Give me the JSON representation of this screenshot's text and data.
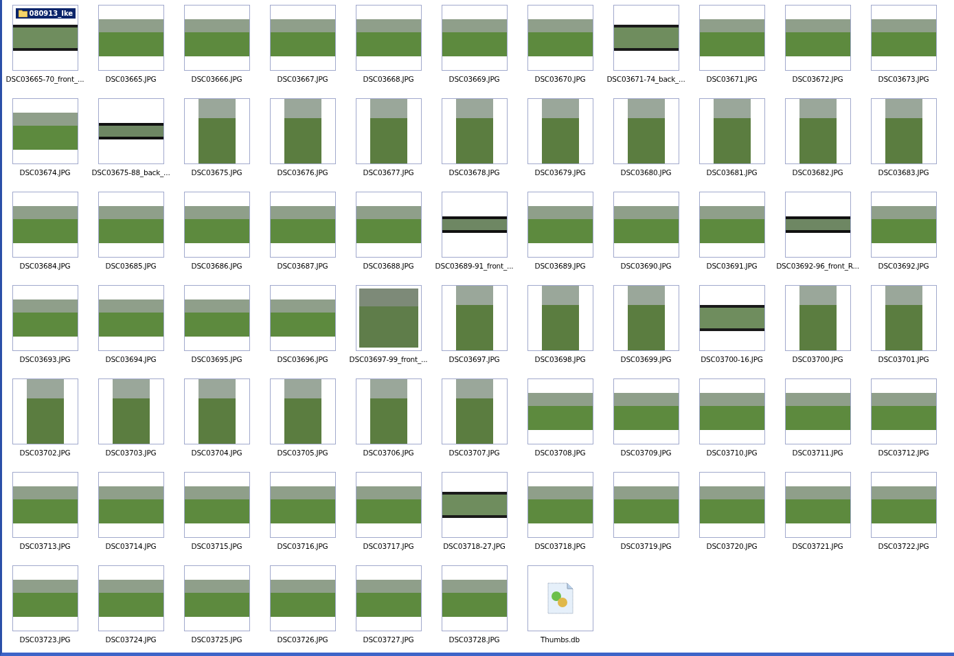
{
  "items": [
    {
      "name": "DSC03665-70_front_...",
      "kind": "pano",
      "badge": "080913_Ike"
    },
    {
      "name": "DSC03665.JPG",
      "kind": "wide"
    },
    {
      "name": "DSC03666.JPG",
      "kind": "wide"
    },
    {
      "name": "DSC03667.JPG",
      "kind": "wide"
    },
    {
      "name": "DSC03668.JPG",
      "kind": "wide"
    },
    {
      "name": "DSC03669.JPG",
      "kind": "wide"
    },
    {
      "name": "DSC03670.JPG",
      "kind": "wide"
    },
    {
      "name": "DSC03671-74_back_...",
      "kind": "pano"
    },
    {
      "name": "DSC03671.JPG",
      "kind": "wide"
    },
    {
      "name": "DSC03672.JPG",
      "kind": "wide"
    },
    {
      "name": "DSC03673.JPG",
      "kind": "wide"
    },
    {
      "name": "DSC03674.JPG",
      "kind": "wide"
    },
    {
      "name": "DSC03675-88_back_...",
      "kind": "strip"
    },
    {
      "name": "DSC03675.JPG",
      "kind": "portrait"
    },
    {
      "name": "DSC03676.JPG",
      "kind": "portrait"
    },
    {
      "name": "DSC03677.JPG",
      "kind": "portrait"
    },
    {
      "name": "DSC03678.JPG",
      "kind": "portrait"
    },
    {
      "name": "DSC03679.JPG",
      "kind": "portrait"
    },
    {
      "name": "DSC03680.JPG",
      "kind": "portrait"
    },
    {
      "name": "DSC03681.JPG",
      "kind": "portrait"
    },
    {
      "name": "DSC03682.JPG",
      "kind": "portrait"
    },
    {
      "name": "DSC03683.JPG",
      "kind": "portrait"
    },
    {
      "name": "DSC03684.JPG",
      "kind": "wide"
    },
    {
      "name": "DSC03685.JPG",
      "kind": "wide"
    },
    {
      "name": "DSC03686.JPG",
      "kind": "wide"
    },
    {
      "name": "DSC03687.JPG",
      "kind": "wide"
    },
    {
      "name": "DSC03688.JPG",
      "kind": "wide"
    },
    {
      "name": "DSC03689-91_front_...",
      "kind": "strip"
    },
    {
      "name": "DSC03689.JPG",
      "kind": "wide"
    },
    {
      "name": "DSC03690.JPG",
      "kind": "wide"
    },
    {
      "name": "DSC03691.JPG",
      "kind": "wide"
    },
    {
      "name": "DSC03692-96_front_R...",
      "kind": "strip"
    },
    {
      "name": "DSC03692.JPG",
      "kind": "wide"
    },
    {
      "name": "DSC03693.JPG",
      "kind": "wide"
    },
    {
      "name": "DSC03694.JPG",
      "kind": "wide"
    },
    {
      "name": "DSC03695.JPG",
      "kind": "wide"
    },
    {
      "name": "DSC03696.JPG",
      "kind": "wide"
    },
    {
      "name": "DSC03697-99_front_...",
      "kind": "square"
    },
    {
      "name": "DSC03697.JPG",
      "kind": "portrait"
    },
    {
      "name": "DSC03698.JPG",
      "kind": "portrait"
    },
    {
      "name": "DSC03699.JPG",
      "kind": "portrait"
    },
    {
      "name": "DSC03700-16.JPG",
      "kind": "pano"
    },
    {
      "name": "DSC03700.JPG",
      "kind": "portrait"
    },
    {
      "name": "DSC03701.JPG",
      "kind": "portrait"
    },
    {
      "name": "DSC03702.JPG",
      "kind": "portrait"
    },
    {
      "name": "DSC03703.JPG",
      "kind": "portrait"
    },
    {
      "name": "DSC03704.JPG",
      "kind": "portrait"
    },
    {
      "name": "DSC03705.JPG",
      "kind": "portrait"
    },
    {
      "name": "DSC03706.JPG",
      "kind": "portrait"
    },
    {
      "name": "DSC03707.JPG",
      "kind": "portrait"
    },
    {
      "name": "DSC03708.JPG",
      "kind": "wide"
    },
    {
      "name": "DSC03709.JPG",
      "kind": "wide"
    },
    {
      "name": "DSC03710.JPG",
      "kind": "wide"
    },
    {
      "name": "DSC03711.JPG",
      "kind": "wide"
    },
    {
      "name": "DSC03712.JPG",
      "kind": "wide"
    },
    {
      "name": "DSC03713.JPG",
      "kind": "wide"
    },
    {
      "name": "DSC03714.JPG",
      "kind": "wide"
    },
    {
      "name": "DSC03715.JPG",
      "kind": "wide"
    },
    {
      "name": "DSC03716.JPG",
      "kind": "wide"
    },
    {
      "name": "DSC03717.JPG",
      "kind": "wide"
    },
    {
      "name": "DSC03718-27.JPG",
      "kind": "pano"
    },
    {
      "name": "DSC03718.JPG",
      "kind": "wide"
    },
    {
      "name": "DSC03719.JPG",
      "kind": "wide"
    },
    {
      "name": "DSC03720.JPG",
      "kind": "wide"
    },
    {
      "name": "DSC03721.JPG",
      "kind": "wide"
    },
    {
      "name": "DSC03722.JPG",
      "kind": "wide"
    },
    {
      "name": "DSC03723.JPG",
      "kind": "wide"
    },
    {
      "name": "DSC03724.JPG",
      "kind": "wide"
    },
    {
      "name": "DSC03725.JPG",
      "kind": "wide"
    },
    {
      "name": "DSC03726.JPG",
      "kind": "wide"
    },
    {
      "name": "DSC03727.JPG",
      "kind": "wide"
    },
    {
      "name": "DSC03728.JPG",
      "kind": "wide"
    },
    {
      "name": "Thumbs.db",
      "kind": "file"
    }
  ]
}
